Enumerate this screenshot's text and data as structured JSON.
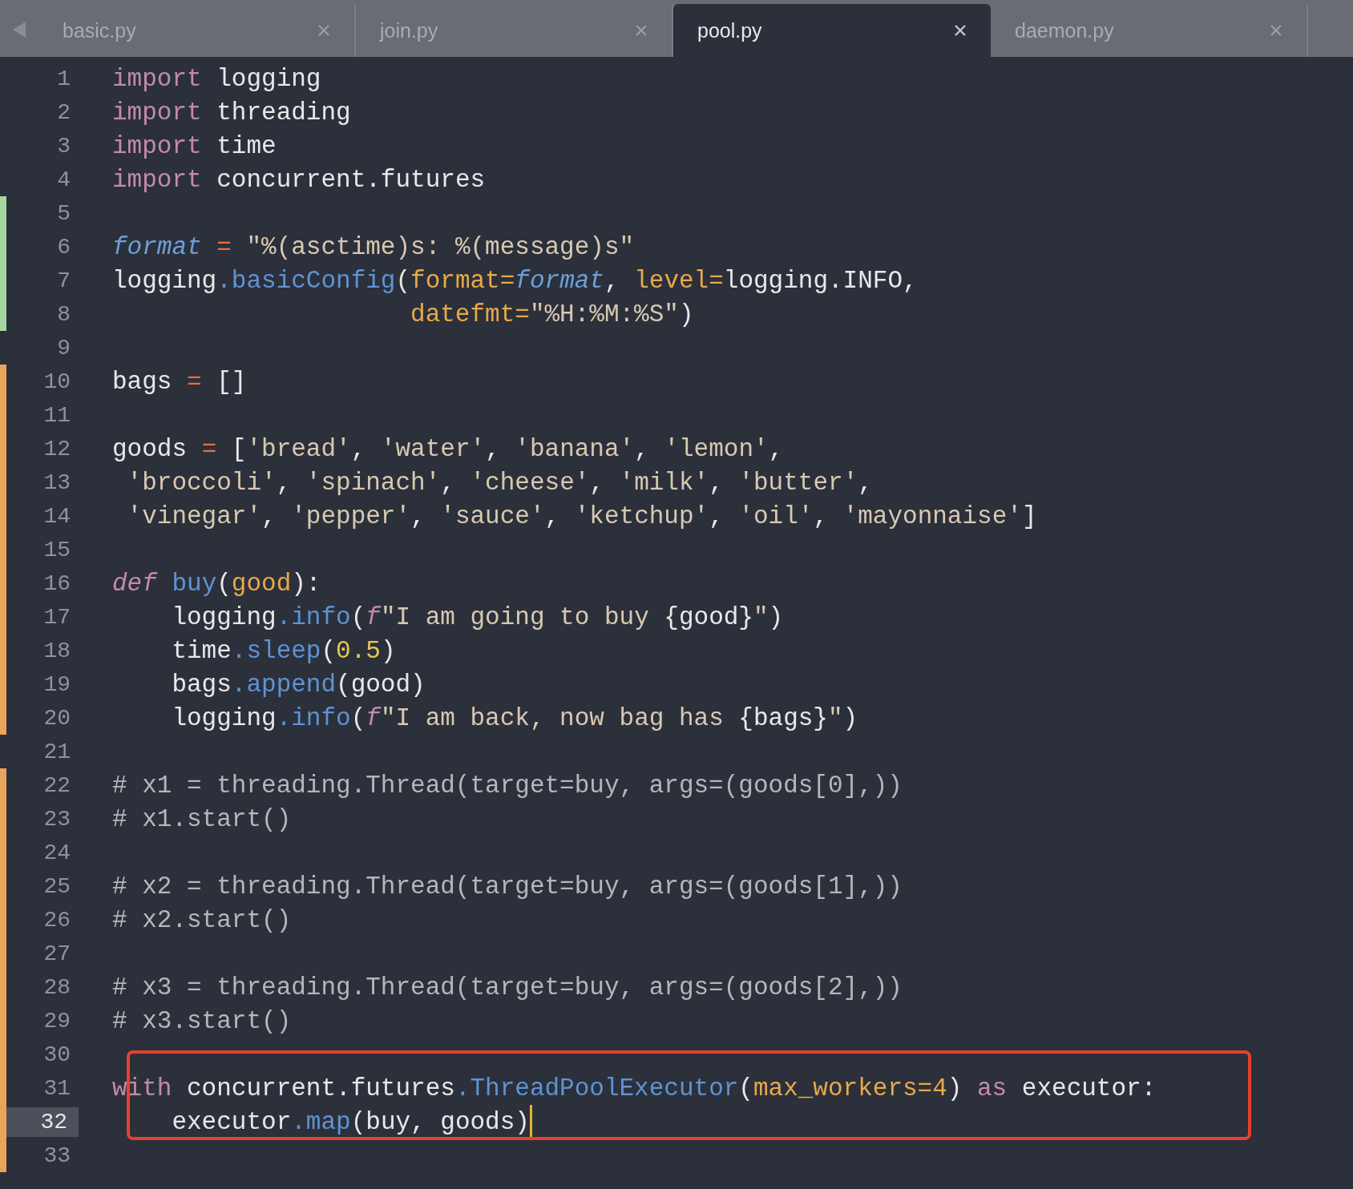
{
  "tabs": [
    {
      "label": "basic.py",
      "selected": false
    },
    {
      "label": "join.py",
      "selected": false
    },
    {
      "label": "pool.py",
      "selected": true
    },
    {
      "label": "daemon.py",
      "selected": false
    }
  ],
  "lines": [
    {
      "number": "1",
      "kind": "plain",
      "current": false,
      "tokens": [
        {
          "kind": "kw",
          "text": "import "
        },
        {
          "kind": "name",
          "text": "logging"
        }
      ]
    },
    {
      "number": "2",
      "kind": "plain",
      "current": false,
      "tokens": [
        {
          "kind": "kw",
          "text": "import "
        },
        {
          "kind": "name",
          "text": "threading"
        }
      ]
    },
    {
      "number": "3",
      "kind": "plain",
      "current": false,
      "tokens": [
        {
          "kind": "kw",
          "text": "import "
        },
        {
          "kind": "name",
          "text": "time"
        }
      ]
    },
    {
      "number": "4",
      "kind": "plain",
      "current": false,
      "tokens": [
        {
          "kind": "kw",
          "text": "import "
        },
        {
          "kind": "name",
          "text": "concurrent.futures"
        }
      ]
    },
    {
      "number": "5",
      "kind": "added",
      "current": false
    },
    {
      "number": "6",
      "kind": "added",
      "current": false,
      "tokens": [
        {
          "kind": "var",
          "text": "format"
        },
        {
          "kind": "op",
          "text": " = "
        },
        {
          "kind": "str",
          "text": "\"%(asctime)s: %(message)s\""
        }
      ]
    },
    {
      "number": "7",
      "kind": "added",
      "current": false,
      "tokens": [
        {
          "kind": "name",
          "text": "logging"
        },
        {
          "kind": "fn",
          "text": ".basicConfig"
        },
        {
          "kind": "name",
          "text": "("
        },
        {
          "kind": "param",
          "text": "format="
        },
        {
          "kind": "var",
          "text": "format"
        },
        {
          "kind": "name",
          "text": ", "
        },
        {
          "kind": "param",
          "text": "level="
        },
        {
          "kind": "name",
          "text": "logging.INFO,"
        }
      ]
    },
    {
      "number": "8",
      "kind": "added",
      "current": false,
      "tokens": [
        {
          "kind": "param",
          "text": "                    datefmt="
        },
        {
          "kind": "str",
          "text": "\"%H:%M:%S\""
        },
        {
          "kind": "name",
          "text": ")"
        }
      ]
    },
    {
      "number": "9",
      "kind": "plain",
      "current": false
    },
    {
      "number": "10",
      "kind": "modified",
      "current": false,
      "tokens": [
        {
          "kind": "name",
          "text": "bags "
        },
        {
          "kind": "op",
          "text": "= "
        },
        {
          "kind": "name",
          "text": "[]"
        }
      ]
    },
    {
      "number": "11",
      "kind": "modified",
      "current": false
    },
    {
      "number": "12",
      "kind": "modified",
      "current": false,
      "tokens": [
        {
          "kind": "name",
          "text": "goods "
        },
        {
          "kind": "op",
          "text": "= "
        },
        {
          "kind": "name",
          "text": "["
        },
        {
          "kind": "str",
          "text": "'bread'"
        },
        {
          "kind": "name",
          "text": ", "
        },
        {
          "kind": "str",
          "text": "'water'"
        },
        {
          "kind": "name",
          "text": ", "
        },
        {
          "kind": "str",
          "text": "'banana'"
        },
        {
          "kind": "name",
          "text": ", "
        },
        {
          "kind": "str",
          "text": "'lemon'"
        },
        {
          "kind": "name",
          "text": ","
        }
      ]
    },
    {
      "number": "13",
      "kind": "modified",
      "current": false,
      "tokens": [
        {
          "kind": "str",
          "text": " 'broccoli'"
        },
        {
          "kind": "name",
          "text": ", "
        },
        {
          "kind": "str",
          "text": "'spinach'"
        },
        {
          "kind": "name",
          "text": ", "
        },
        {
          "kind": "str",
          "text": "'cheese'"
        },
        {
          "kind": "name",
          "text": ", "
        },
        {
          "kind": "str",
          "text": "'milk'"
        },
        {
          "kind": "name",
          "text": ", "
        },
        {
          "kind": "str",
          "text": "'butter'"
        },
        {
          "kind": "name",
          "text": ","
        }
      ]
    },
    {
      "number": "14",
      "kind": "modified",
      "current": false,
      "tokens": [
        {
          "kind": "str",
          "text": " 'vinegar'"
        },
        {
          "kind": "name",
          "text": ", "
        },
        {
          "kind": "str",
          "text": "'pepper'"
        },
        {
          "kind": "name",
          "text": ", "
        },
        {
          "kind": "str",
          "text": "'sauce'"
        },
        {
          "kind": "name",
          "text": ", "
        },
        {
          "kind": "str",
          "text": "'ketchup'"
        },
        {
          "kind": "name",
          "text": ", "
        },
        {
          "kind": "str",
          "text": "'oil'"
        },
        {
          "kind": "name",
          "text": ", "
        },
        {
          "kind": "str",
          "text": "'mayonnaise'"
        },
        {
          "kind": "name",
          "text": "]"
        }
      ]
    },
    {
      "number": "15",
      "kind": "modified",
      "current": false
    },
    {
      "number": "16",
      "kind": "modified",
      "current": false,
      "tokens": [
        {
          "kind": "def",
          "text": "def "
        },
        {
          "kind": "fn",
          "text": "buy"
        },
        {
          "kind": "name",
          "text": "("
        },
        {
          "kind": "param",
          "text": "good"
        },
        {
          "kind": "name",
          "text": "):"
        }
      ]
    },
    {
      "number": "17",
      "kind": "modified",
      "current": false,
      "tokens": [
        {
          "kind": "name",
          "text": "    logging"
        },
        {
          "kind": "fn",
          "text": ".info"
        },
        {
          "kind": "name",
          "text": "("
        },
        {
          "kind": "def",
          "text": "f"
        },
        {
          "kind": "str",
          "text": "\"I am going to buy "
        },
        {
          "kind": "name",
          "text": "{good}"
        },
        {
          "kind": "str",
          "text": "\""
        },
        {
          "kind": "name",
          "text": ")"
        }
      ]
    },
    {
      "number": "18",
      "kind": "modified",
      "current": false,
      "tokens": [
        {
          "kind": "name",
          "text": "    time"
        },
        {
          "kind": "fn",
          "text": ".sleep"
        },
        {
          "kind": "name",
          "text": "("
        },
        {
          "kind": "num",
          "text": "0.5"
        },
        {
          "kind": "name",
          "text": ")"
        }
      ]
    },
    {
      "number": "19",
      "kind": "modified",
      "current": false,
      "tokens": [
        {
          "kind": "name",
          "text": "    bags"
        },
        {
          "kind": "fn",
          "text": ".append"
        },
        {
          "kind": "name",
          "text": "(good)"
        }
      ]
    },
    {
      "number": "20",
      "kind": "modified",
      "current": false,
      "tokens": [
        {
          "kind": "name",
          "text": "    logging"
        },
        {
          "kind": "fn",
          "text": ".info"
        },
        {
          "kind": "name",
          "text": "("
        },
        {
          "kind": "def",
          "text": "f"
        },
        {
          "kind": "str",
          "text": "\"I am back, now bag has "
        },
        {
          "kind": "name",
          "text": "{bags}"
        },
        {
          "kind": "str",
          "text": "\""
        },
        {
          "kind": "name",
          "text": ")"
        }
      ]
    },
    {
      "number": "21",
      "kind": "plain",
      "current": false
    },
    {
      "number": "22",
      "kind": "modified",
      "current": false,
      "tokens": [
        {
          "kind": "comment",
          "text": "# x1 = threading.Thread(target=buy, args=(goods[0],))"
        }
      ]
    },
    {
      "number": "23",
      "kind": "modified",
      "current": false,
      "tokens": [
        {
          "kind": "comment",
          "text": "# x1.start()"
        }
      ]
    },
    {
      "number": "24",
      "kind": "modified",
      "current": false
    },
    {
      "number": "25",
      "kind": "modified",
      "current": false,
      "tokens": [
        {
          "kind": "comment",
          "text": "# x2 = threading.Thread(target=buy, args=(goods[1],))"
        }
      ]
    },
    {
      "number": "26",
      "kind": "modified",
      "current": false,
      "tokens": [
        {
          "kind": "comment",
          "text": "# x2.start()"
        }
      ]
    },
    {
      "number": "27",
      "kind": "modified",
      "current": false
    },
    {
      "number": "28",
      "kind": "modified",
      "current": false,
      "tokens": [
        {
          "kind": "comment",
          "text": "# x3 = threading.Thread(target=buy, args=(goods[2],))"
        }
      ]
    },
    {
      "number": "29",
      "kind": "modified",
      "current": false,
      "tokens": [
        {
          "kind": "comment",
          "text": "# x3.start()"
        }
      ]
    },
    {
      "number": "30",
      "kind": "modified",
      "current": false
    },
    {
      "number": "31",
      "kind": "modified",
      "current": false,
      "boxed": true,
      "tokens": [
        {
          "kind": "kw",
          "text": "with "
        },
        {
          "kind": "name",
          "text": "concurrent.futures"
        },
        {
          "kind": "fn",
          "text": ".ThreadPoolExecutor"
        },
        {
          "kind": "name",
          "text": "("
        },
        {
          "kind": "param",
          "text": "max_workers=4"
        },
        {
          "kind": "name",
          "text": ") "
        },
        {
          "kind": "kw",
          "text": "as "
        },
        {
          "kind": "name",
          "text": "executor:"
        }
      ]
    },
    {
      "number": "32",
      "kind": "modified",
      "current": true,
      "cursor": true,
      "boxed": true,
      "tokens": [
        {
          "kind": "name",
          "text": "    executor"
        },
        {
          "kind": "fn",
          "text": ".map"
        },
        {
          "kind": "name",
          "text": "(buy, goods)"
        }
      ]
    },
    {
      "number": "33",
      "kind": "modified",
      "current": false
    }
  ]
}
